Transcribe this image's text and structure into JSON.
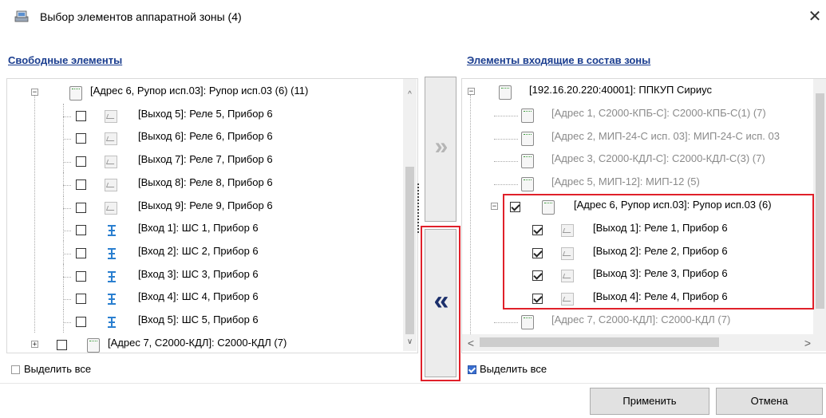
{
  "window": {
    "title": "Выбор элементов аппаратной зоны (4)"
  },
  "left": {
    "header": "Свободные элементы",
    "tree": [
      {
        "label": "[Адрес 6, Рупор исп.03]: Рупор исп.03 (6) (11)",
        "kind": "device",
        "expander": "−"
      },
      {
        "label": "[Выход 5]: Реле 5, Прибор 6",
        "kind": "relay"
      },
      {
        "label": "[Выход 6]: Реле 6, Прибор 6",
        "kind": "relay"
      },
      {
        "label": "[Выход 7]: Реле 7, Прибор 6",
        "kind": "relay"
      },
      {
        "label": "[Выход 8]: Реле 8, Прибор 6",
        "kind": "relay"
      },
      {
        "label": "[Выход 9]: Реле 9, Прибор 6",
        "kind": "relay"
      },
      {
        "label": "[Вход 1]: ШС 1, Прибор 6",
        "kind": "input"
      },
      {
        "label": "[Вход 2]: ШС 2, Прибор 6",
        "kind": "input"
      },
      {
        "label": "[Вход 3]: ШС 3, Прибор 6",
        "kind": "input"
      },
      {
        "label": "[Вход 4]: ШС 4, Прибор 6",
        "kind": "input"
      },
      {
        "label": "[Вход 5]: ШС 5, Прибор 6",
        "kind": "input"
      },
      {
        "label": "[Адрес 7, С2000-КДЛ]: С2000-КДЛ (7)",
        "kind": "device",
        "expander": "+"
      }
    ],
    "select_all": "Выделить все",
    "select_all_checked": false
  },
  "middle": {
    "add_label": "»",
    "remove_label": "«"
  },
  "right": {
    "header": "Элементы входящие в состав зоны",
    "tree": [
      {
        "label": "[192.16.20.220:40001]: ППКУП Сириус",
        "kind": "device",
        "expander": "−",
        "gray": false
      },
      {
        "label": "[Адрес 1, С2000-КПБ-С]: С2000-КПБ-С(1) (7)",
        "kind": "device",
        "gray": true
      },
      {
        "label": "[Адрес 2, МИП-24-С исп. 03]: МИП-24-С исп. 03",
        "kind": "device",
        "gray": true
      },
      {
        "label": "[Адрес 3, С2000-КДЛ-С]: С2000-КДЛ-С(3) (7)",
        "kind": "device",
        "gray": true
      },
      {
        "label": "[Адрес 5, МИП-12]: МИП-12 (5)",
        "kind": "device",
        "gray": true
      },
      {
        "label": "[Адрес 6, Рупор исп.03]: Рупор исп.03 (6)",
        "kind": "device",
        "expander": "−",
        "gray": false,
        "checked": true
      },
      {
        "label": "[Выход 1]: Реле 1, Прибор 6",
        "kind": "relay",
        "checked": true
      },
      {
        "label": "[Выход 2]: Реле 2, Прибор 6",
        "kind": "relay",
        "checked": true
      },
      {
        "label": "[Выход 3]: Реле 3, Прибор 6",
        "kind": "relay",
        "checked": true
      },
      {
        "label": "[Выход 4]: Реле 4, Прибор 6",
        "kind": "relay",
        "checked": true
      },
      {
        "label": "[Адрес 7, С2000-КДЛ]: С2000-КДЛ (7)",
        "kind": "device",
        "gray": true
      }
    ],
    "select_all": "Выделить все",
    "select_all_checked": true
  },
  "footer": {
    "apply_label": "Применить",
    "cancel_label": "Отмена"
  },
  "colors": {
    "header_link": "#1a3d8f",
    "highlight": "#e0202a",
    "gray_text": "#8a8a8a"
  }
}
